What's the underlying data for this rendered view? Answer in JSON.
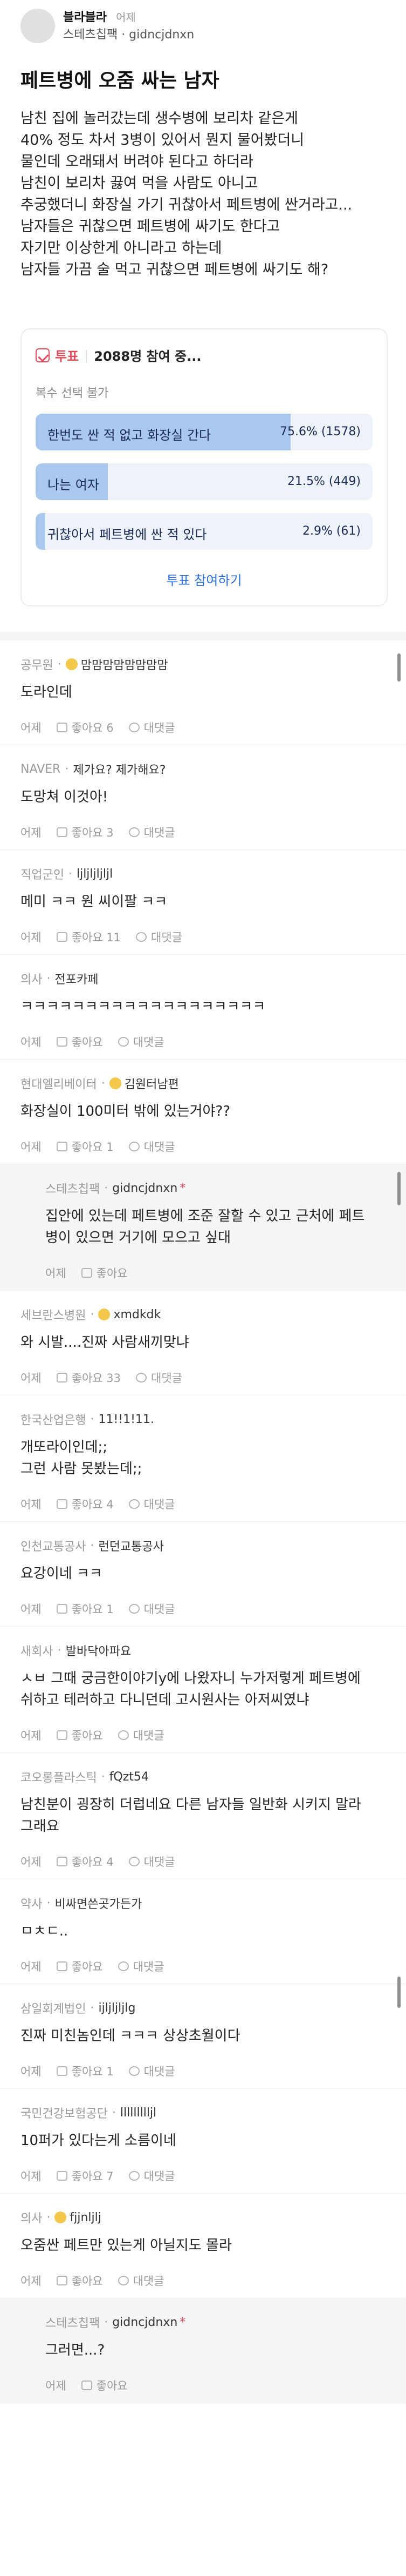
{
  "post": {
    "author": "블라블라",
    "time": "어제",
    "sub": "스테츠칩팩 · gidncjdnxn",
    "title": "페트병에 오줌 싸는 남자",
    "body": [
      "남친 집에 놀러갔는데 생수병에 보리차 같은게",
      "40% 정도 차서 3병이 있어서 뭔지 물어봤더니",
      "물인데 오래돼서 버려야 된다고 하더라",
      "남친이 보리차 끓여 먹을 사람도 아니고",
      "추궁했더니 화장실 가기 귀찮아서 페트병에 싼거라고...",
      "남자들은 귀찮으면 페트병에 싸기도 한다고",
      "자기만 이상한게 아니라고 하는데",
      "남자들 가끔 술 먹고 귀찮으면 페트병에 싸기도 해?"
    ]
  },
  "poll": {
    "tag": "투표",
    "count": "2088명 참여 중...",
    "note": "복수 선택 불가",
    "options": [
      {
        "label": "한번도 싼 적 없고 화장실 간다",
        "value": "75.6% (1578)",
        "pct": 75.6
      },
      {
        "label": "나는 여자",
        "value": "21.5% (449)",
        "pct": 21.5
      },
      {
        "label": "귀찮아서 페트병에 싼 적 있다",
        "value": "2.9% (61)",
        "pct": 2.9
      }
    ],
    "button": "투표 참여하기"
  },
  "comments": [
    {
      "org": "공무원",
      "nick": "맘맘맘맘맘맘맘맘",
      "badge": true,
      "text": [
        "도라인데"
      ],
      "time": "어제",
      "likes": "좋아요 6",
      "reply": "대댓글"
    },
    {
      "org": "NAVER",
      "nick": "제가요? 제가해요?",
      "text": [
        "도망쳐 이것아!"
      ],
      "time": "어제",
      "likes": "좋아요 3",
      "reply": "대댓글"
    },
    {
      "org": "직업군인",
      "nick": "ljljljljljl",
      "text": [
        "메미 ㅋㅋ 원 씨이팔 ㅋㅋ"
      ],
      "time": "어제",
      "likes": "좋아요 11",
      "reply": "대댓글"
    },
    {
      "org": "의사",
      "nick": "전포카페",
      "text": [
        "ㅋㅋㅋㅋㅋㅋㅋㅋㅋㅋㅋㅋㅋㅋㅋㅋㅋㅋㅋ"
      ],
      "time": "어제",
      "likes": "좋아요",
      "reply": "대댓글"
    },
    {
      "org": "현대엘리베이터",
      "nick": "김원터남편",
      "badge": true,
      "text": [
        "화장실이 100미터 밖에 있는거야??"
      ],
      "time": "어제",
      "likes": "좋아요 1",
      "reply": "대댓글"
    },
    {
      "org": "스테츠칩팩",
      "nick": "gidncjdnxn",
      "star": "*",
      "isReply": true,
      "text": [
        "집안에 있는데 페트병에 조준 잘할 수 있고 근처에 페트",
        "병이 있으면 거기에 모으고 싶대"
      ],
      "time": "어제",
      "likes": "좋아요",
      "reply": ""
    },
    {
      "org": "세브란스병원",
      "nick": "xmdkdk",
      "badge": true,
      "text": [
        "와 시발....진짜 사람새끼맞냐"
      ],
      "time": "어제",
      "likes": "좋아요 33",
      "reply": "대댓글"
    },
    {
      "org": "한국산업은행",
      "nick": "11!!1!11.",
      "text": [
        "개또라이인데;;",
        "그런 사람 못봤는데;;"
      ],
      "time": "어제",
      "likes": "좋아요 4",
      "reply": "대댓글"
    },
    {
      "org": "인천교통공사",
      "nick": "런던교통공사",
      "text": [
        "요강이네 ㅋㅋ"
      ],
      "time": "어제",
      "likes": "좋아요 1",
      "reply": "대댓글"
    },
    {
      "org": "새회사",
      "nick": "발바닥아파요",
      "text": [
        "ㅅㅂ 그때 궁금한이야기y에 나왔자니 누가저렇게 페트병에",
        "쉬하고 테러하고 다니던데 고시원사는 아저씨였냐"
      ],
      "time": "어제",
      "likes": "좋아요",
      "reply": "대댓글"
    },
    {
      "org": "코오롱플라스틱",
      "nick": "fQzt54",
      "text": [
        "남친분이 굉장히 더럽네요 다른 남자들 일반화 시키지 말라",
        "그래요"
      ],
      "time": "어제",
      "likes": "좋아요 4",
      "reply": "대댓글"
    },
    {
      "org": "약사",
      "nick": "비싸면쓴곳가든가",
      "text": [
        "ㅁㅊㄷ.."
      ],
      "time": "어제",
      "likes": "좋아요",
      "reply": "대댓글"
    },
    {
      "org": "삼일회계법인",
      "nick": "ijljljljlg",
      "text": [
        "진짜 미친놈인데 ㅋㅋㅋ 상상초월이다"
      ],
      "time": "어제",
      "likes": "좋아요 1",
      "reply": "대댓글"
    },
    {
      "org": "국민건강보험공단",
      "nick": "llllllllljl",
      "text": [
        "10퍼가 있다는게 소름이네"
      ],
      "time": "어제",
      "likes": "좋아요 7",
      "reply": "대댓글"
    },
    {
      "org": "의사",
      "nick": "fjjnljlj",
      "badge": true,
      "text": [
        "오줌싼 페트만 있는게 아닐지도 몰라"
      ],
      "time": "어제",
      "likes": "좋아요",
      "reply": "대댓글"
    },
    {
      "org": "스테츠칩팩",
      "nick": "gidncjdnxn",
      "star": "*",
      "isReply": true,
      "text": [
        "그러면...?"
      ],
      "time": "어제",
      "likes": "좋아요",
      "reply": ""
    }
  ]
}
